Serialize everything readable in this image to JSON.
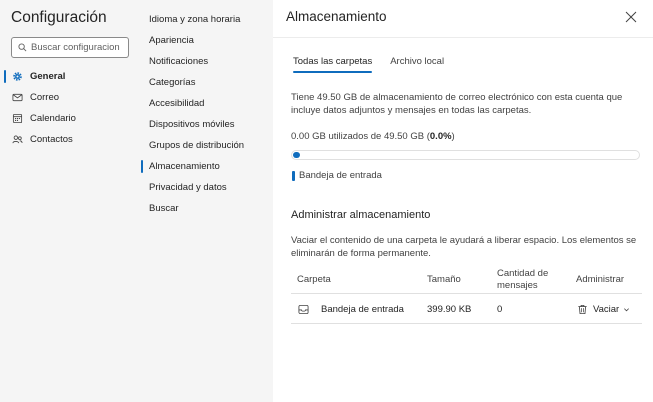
{
  "app": {
    "title": "Configuración",
    "search_placeholder": "Buscar configuracion"
  },
  "nav": {
    "items": [
      {
        "label": "General",
        "icon": "gear-icon",
        "active": true
      },
      {
        "label": "Correo",
        "icon": "mail-icon",
        "active": false
      },
      {
        "label": "Calendario",
        "icon": "calendar-icon",
        "active": false
      },
      {
        "label": "Contactos",
        "icon": "people-icon",
        "active": false
      }
    ]
  },
  "subnav": {
    "items": [
      {
        "label": "Idioma y zona horaria"
      },
      {
        "label": "Apariencia"
      },
      {
        "label": "Notificaciones"
      },
      {
        "label": "Categorías"
      },
      {
        "label": "Accesibilidad"
      },
      {
        "label": "Dispositivos móviles"
      },
      {
        "label": "Grupos de distribución"
      },
      {
        "label": "Almacenamiento",
        "active": true
      },
      {
        "label": "Privacidad y datos"
      },
      {
        "label": "Buscar"
      }
    ]
  },
  "panel": {
    "title": "Almacenamiento",
    "tabs": [
      {
        "label": "Todas las carpetas",
        "active": true
      },
      {
        "label": "Archivo local",
        "active": false
      }
    ],
    "description": "Tiene 49.50 GB de almacenamiento de correo electrónico con esta cuenta que incluye datos adjuntos y mensajes en todas las carpetas.",
    "usage_prefix": "0.00 GB utilizados de 49.50 GB (",
    "usage_percent": "0.0%",
    "usage_suffix": ")",
    "usage_fraction": 0.0,
    "legend_label": "Bandeja de entrada",
    "accent_color": "#0f6cbd",
    "manage_title": "Administrar almacenamiento",
    "manage_description": "Vaciar el contenido de una carpeta le ayudará a liberar espacio. Los elementos se eliminarán de forma permanente.",
    "table": {
      "headers": {
        "folder": "Carpeta",
        "size": "Tamaño",
        "count": "Cantidad de mensajes",
        "manage": "Administrar"
      },
      "rows": [
        {
          "icon": "inbox-icon",
          "folder": "Bandeja de entrada",
          "size": "399.90 KB",
          "count": "0",
          "action": "Vaciar"
        }
      ]
    }
  }
}
